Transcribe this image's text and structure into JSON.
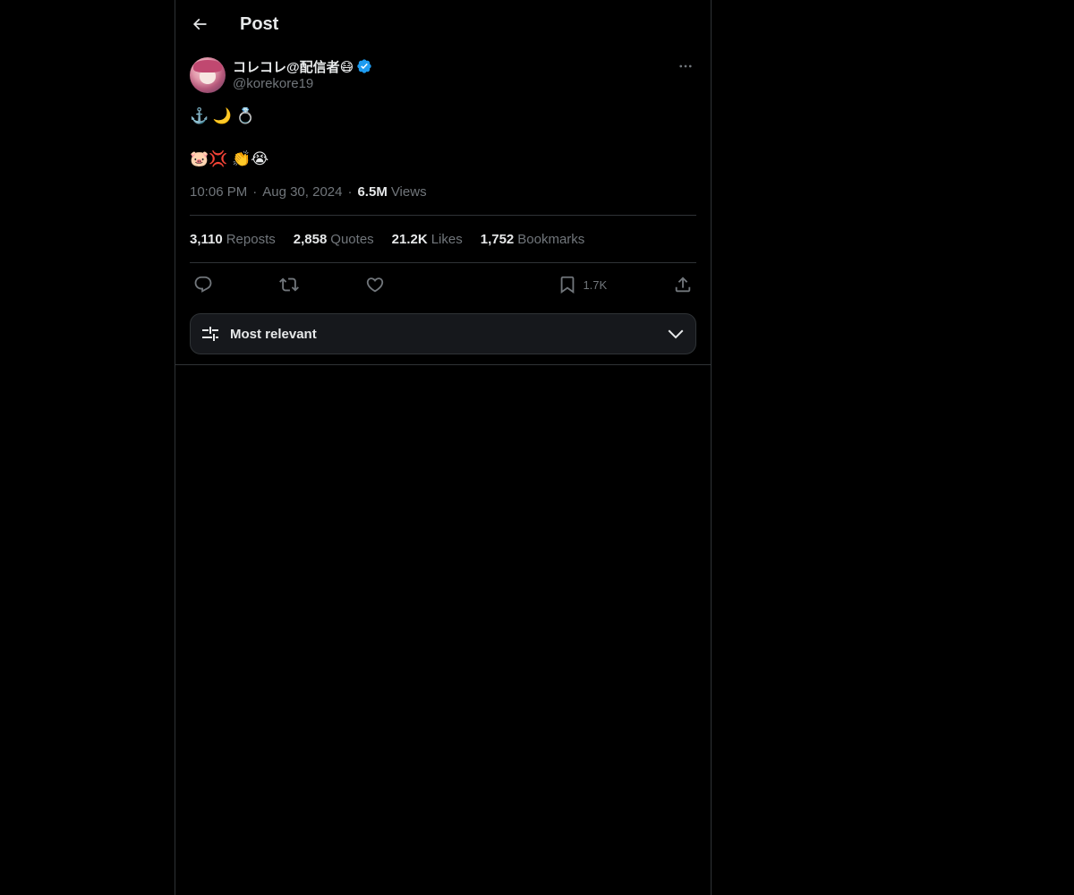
{
  "header": {
    "title": "Post",
    "back_icon": "arrow-left-icon"
  },
  "author": {
    "display_name": "コレコレ@配信者😷",
    "handle": "@korekore19",
    "verified_color": "#1d9bf0"
  },
  "post": {
    "lines": [
      "⚓️ 🌙 💍",
      "🐷💢 👏😭"
    ],
    "time": "10:06 PM",
    "date": "Aug 30, 2024",
    "views_count": "6.5M",
    "views_label": "Views"
  },
  "stats": [
    {
      "count": "3,110",
      "label": "Reposts"
    },
    {
      "count": "2,858",
      "label": "Quotes"
    },
    {
      "count": "21.2K",
      "label": "Likes"
    },
    {
      "count": "1,752",
      "label": "Bookmarks"
    }
  ],
  "actions": {
    "reply_icon": "reply-icon",
    "repost_icon": "repost-icon",
    "like_icon": "heart-icon",
    "bookmark_icon": "bookmark-icon",
    "bookmark_count": "1.7K",
    "share_icon": "share-icon"
  },
  "sort": {
    "label": "Most relevant",
    "icon": "sliders-icon",
    "chevron": "chevron-down-icon"
  },
  "colors": {
    "background": "#000000",
    "text": "#e7e9ea",
    "muted": "#71767b",
    "border": "#2f3336",
    "accent": "#1d9bf0"
  }
}
